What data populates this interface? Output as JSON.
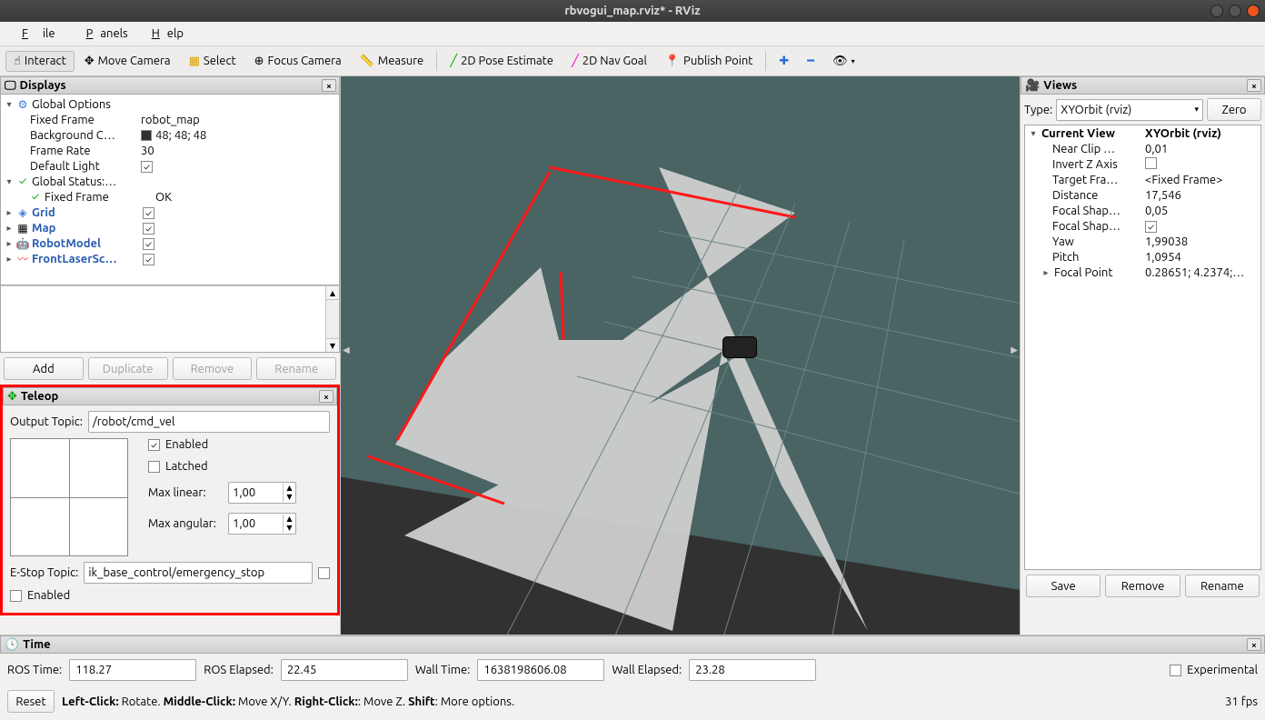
{
  "window": {
    "title": "rbvogui_map.rviz* - RViz"
  },
  "menubar": {
    "file": "File",
    "panels": "Panels",
    "help": "Help"
  },
  "toolbar": {
    "interact": "Interact",
    "move_camera": "Move Camera",
    "select": "Select",
    "focus_camera": "Focus Camera",
    "measure": "Measure",
    "pose_estimate": "2D Pose Estimate",
    "nav_goal": "2D Nav Goal",
    "publish_point": "Publish Point"
  },
  "displays": {
    "title": "Displays",
    "global_options": "Global Options",
    "fixed_frame": {
      "label": "Fixed Frame",
      "value": "robot_map"
    },
    "bg_color": {
      "label": "Background C…",
      "value": "48; 48; 48"
    },
    "frame_rate": {
      "label": "Frame Rate",
      "value": "30"
    },
    "default_light": {
      "label": "Default Light",
      "checked": true
    },
    "global_status": {
      "label": "Global Status:…"
    },
    "status_fixed_frame": {
      "label": "Fixed Frame",
      "value": "OK"
    },
    "grid": "Grid",
    "map": "Map",
    "robot_model": "RobotModel",
    "laser": "FrontLaserSc…",
    "buttons": {
      "add": "Add",
      "duplicate": "Duplicate",
      "remove": "Remove",
      "rename": "Rename"
    }
  },
  "teleop": {
    "title": "Teleop",
    "output_topic": {
      "label": "Output Topic:",
      "value": "/robot/cmd_vel"
    },
    "enabled": "Enabled",
    "latched": "Latched",
    "max_linear": {
      "label": "Max linear:",
      "value": "1,00"
    },
    "max_angular": {
      "label": "Max angular:",
      "value": "1,00"
    },
    "estop_topic": {
      "label": "E-Stop Topic:",
      "value": "ik_base_control/emergency_stop"
    },
    "estop_enabled": "Enabled"
  },
  "views": {
    "title": "Views",
    "type_label": "Type:",
    "type_value": "XYOrbit (rviz)",
    "zero": "Zero",
    "current_view": {
      "label": "Current View",
      "value": "XYOrbit (rviz)"
    },
    "near_clip": {
      "label": "Near Clip …",
      "value": "0,01"
    },
    "invert_z": {
      "label": "Invert Z Axis",
      "checked": false
    },
    "target_frame": {
      "label": "Target Fra…",
      "value": "<Fixed Frame>"
    },
    "distance": {
      "label": "Distance",
      "value": "17,546"
    },
    "focal_shape_size": {
      "label": "Focal Shap…",
      "value": "0,05"
    },
    "focal_shape_fixed": {
      "label": "Focal Shap…",
      "checked": true
    },
    "yaw": {
      "label": "Yaw",
      "value": "1,99038"
    },
    "pitch": {
      "label": "Pitch",
      "value": "1,0954"
    },
    "focal_point": {
      "label": "Focal Point",
      "value": "0.28651; 4.2374;…"
    },
    "buttons": {
      "save": "Save",
      "remove": "Remove",
      "rename": "Rename"
    }
  },
  "time": {
    "title": "Time",
    "ros_time": {
      "label": "ROS Time:",
      "value": "118.27"
    },
    "ros_elapsed": {
      "label": "ROS Elapsed:",
      "value": "22.45"
    },
    "wall_time": {
      "label": "Wall Time:",
      "value": "1638198606.08"
    },
    "wall_elapsed": {
      "label": "Wall Elapsed:",
      "value": "23.28"
    },
    "experimental": "Experimental",
    "reset": "Reset",
    "hint": "Left-Click: Rotate. Middle-Click: Move X/Y. Right-Click:: Move Z. Shift: More options.",
    "fps": "31 fps"
  }
}
